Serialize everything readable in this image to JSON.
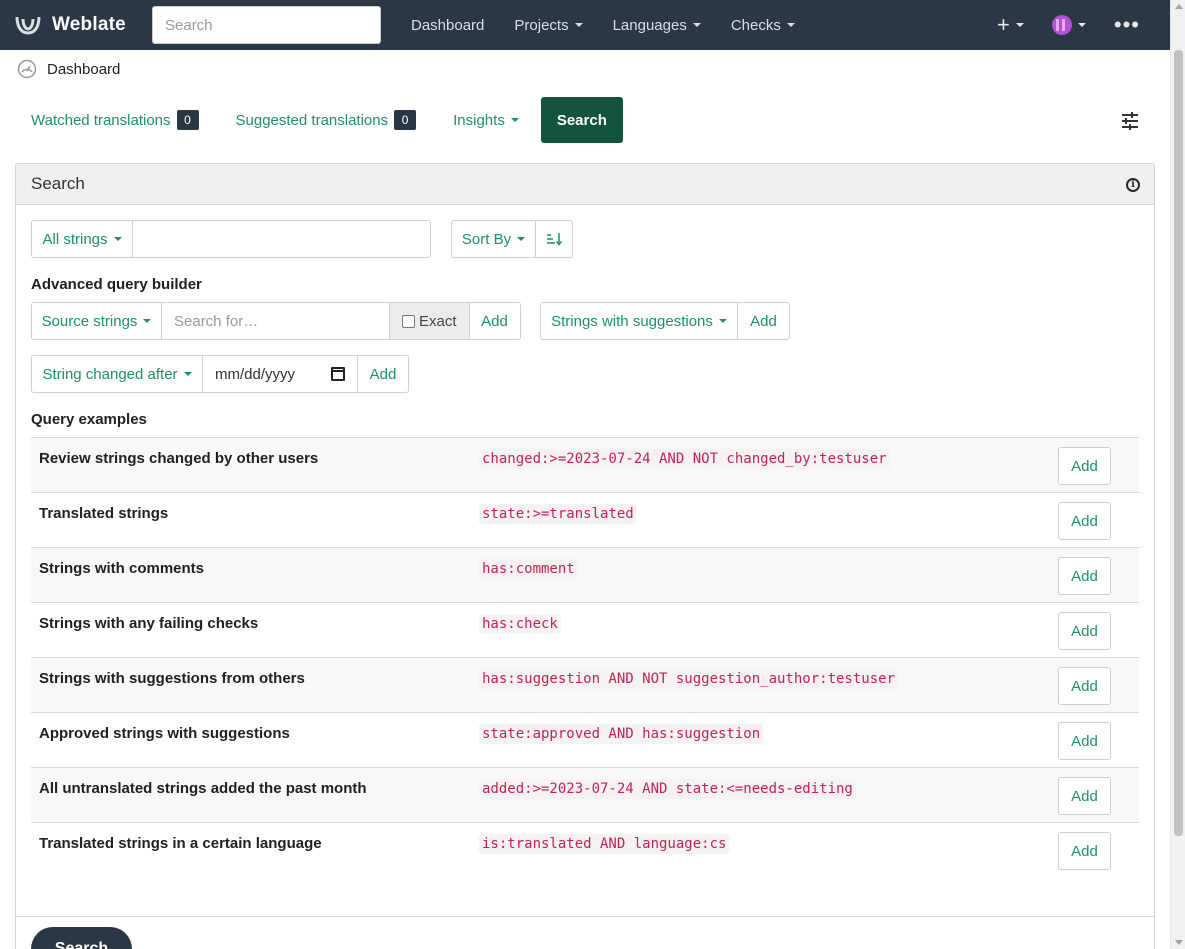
{
  "nav": {
    "brand": "Weblate",
    "search_placeholder": "Search",
    "links": [
      "Dashboard",
      "Projects",
      "Languages",
      "Checks"
    ],
    "plus": "+",
    "more": "•••"
  },
  "breadcrumb": {
    "label": "Dashboard"
  },
  "tabs": {
    "watched": {
      "label": "Watched translations",
      "count": "0"
    },
    "suggested": {
      "label": "Suggested translations",
      "count": "0"
    },
    "insights": "Insights",
    "search": "Search"
  },
  "panel": {
    "title": "Search",
    "info": "i",
    "strings_filter": "All strings",
    "sort_by": "Sort By",
    "sort_direction_icon": "↓",
    "advanced_label": "Advanced query builder",
    "source_strings": "Source strings",
    "search_for_placeholder": "Search for…",
    "exact": "Exact",
    "add": "Add",
    "suggestions_filter": "Strings with suggestions",
    "changed_after": "String changed after",
    "date_placeholder": "mm/dd/yyyy",
    "query_examples_label": "Query examples",
    "submit": "Search"
  },
  "query_examples": [
    {
      "description": "Review strings changed by other users",
      "query": "changed:>=2023-07-24 AND NOT changed_by:testuser",
      "action": "Add"
    },
    {
      "description": "Translated strings",
      "query": "state:>=translated",
      "action": "Add"
    },
    {
      "description": "Strings with comments",
      "query": "has:comment",
      "action": "Add"
    },
    {
      "description": "Strings with any failing checks",
      "query": "has:check",
      "action": "Add"
    },
    {
      "description": "Strings with suggestions from others",
      "query": "has:suggestion AND NOT suggestion_author:testuser",
      "action": "Add"
    },
    {
      "description": "Approved strings with suggestions",
      "query": "state:approved AND has:suggestion",
      "action": "Add"
    },
    {
      "description": "All untranslated strings added the past month",
      "query": "added:>=2023-07-24 AND state:<=needs-editing",
      "action": "Add"
    },
    {
      "description": "Translated strings in a certain language",
      "query": "is:translated AND language:cs",
      "action": "Add"
    }
  ],
  "colors": {
    "navbar": "#2a3744",
    "accent": "#1f8f6a",
    "active_tab": "#14543d",
    "code": "#c3244e"
  },
  "icons": {
    "brand": "weblate-logo-icon",
    "breadcrumb": "dashboard-gauge-icon",
    "settings": "sliders-icon",
    "info": "info-icon",
    "calendar": "calendar-icon",
    "sort": "sort-direction-icon"
  }
}
